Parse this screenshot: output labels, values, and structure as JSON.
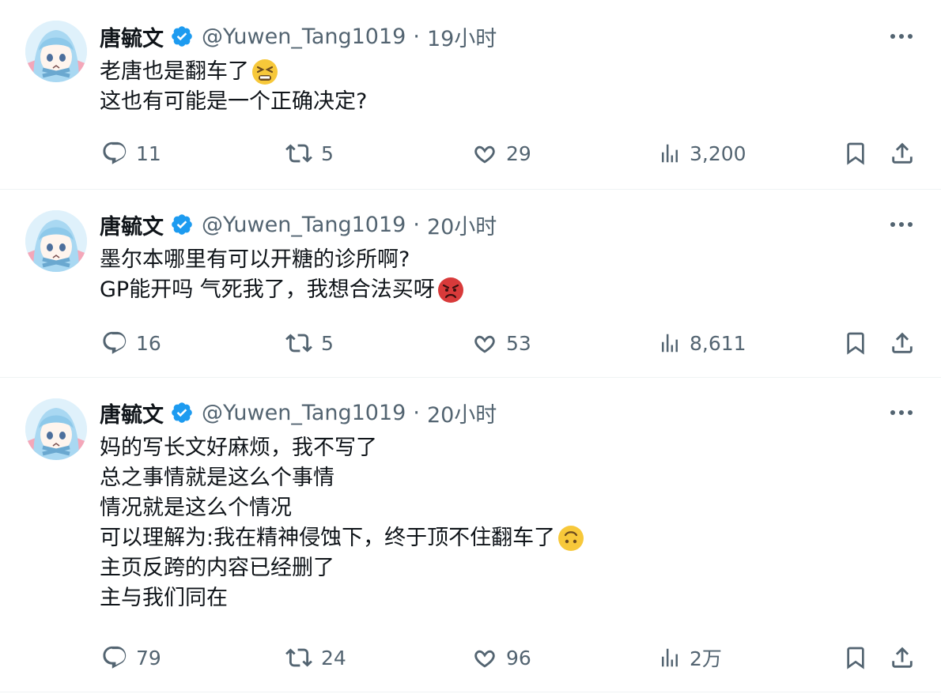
{
  "tweets": [
    {
      "author_name": "唐毓文",
      "handle": "@Yuwen_Tang1019",
      "separator": "·",
      "time": "19小时",
      "lines": [
        "老唐也是翻车了",
        "这也有可能是一个正确决定?"
      ],
      "emoji": [
        "tired-face-emoji",
        null
      ],
      "stats": {
        "replies": "11",
        "retweets": "5",
        "likes": "29",
        "views": "3,200"
      }
    },
    {
      "author_name": "唐毓文",
      "handle": "@Yuwen_Tang1019",
      "separator": "·",
      "time": "20小时",
      "lines": [
        "墨尔本哪里有可以开糖的诊所啊?",
        "GP能开吗 气死我了，我想合法买呀"
      ],
      "emoji": [
        null,
        "angry-face-emoji"
      ],
      "stats": {
        "replies": "16",
        "retweets": "5",
        "likes": "53",
        "views": "8,611"
      }
    },
    {
      "author_name": "唐毓文",
      "handle": "@Yuwen_Tang1019",
      "separator": "·",
      "time": "20小时",
      "lines": [
        "妈的写长文好麻烦，我不写了",
        "总之事情就是这么个事情",
        "情况就是这么个情况",
        "可以理解为:我在精神侵蚀下，终于顶不住翻车了",
        "主页反跨的内容已经删了",
        "主与我们同在"
      ],
      "emoji": [
        null,
        null,
        null,
        "upside-down-face-emoji",
        null,
        null
      ],
      "stats": {
        "replies": "79",
        "retweets": "24",
        "likes": "96",
        "views": "2万"
      }
    }
  ],
  "colors": {
    "text": "#0f1419",
    "secondary": "#536471",
    "verified": "#1d9bf0",
    "divider": "#eff3f4"
  }
}
